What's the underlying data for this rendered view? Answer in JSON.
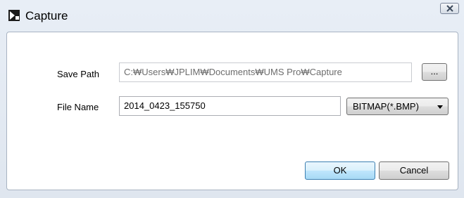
{
  "window": {
    "title": "Capture",
    "close_icon": "close-icon"
  },
  "form": {
    "save_path_label": "Save Path",
    "save_path_value": "C:₩Users₩JPLIM₩Documents₩UMS Pro₩Capture",
    "browse_label": "...",
    "file_name_label": "File Name",
    "file_name_value": "2014_0423_155750",
    "format_selected": "BITMAP(*.BMP)"
  },
  "actions": {
    "ok_label": "OK",
    "cancel_label": "Cancel"
  },
  "colors": {
    "ok_accent": "#3c7fb1",
    "window_bg": "#dfe6ef"
  }
}
